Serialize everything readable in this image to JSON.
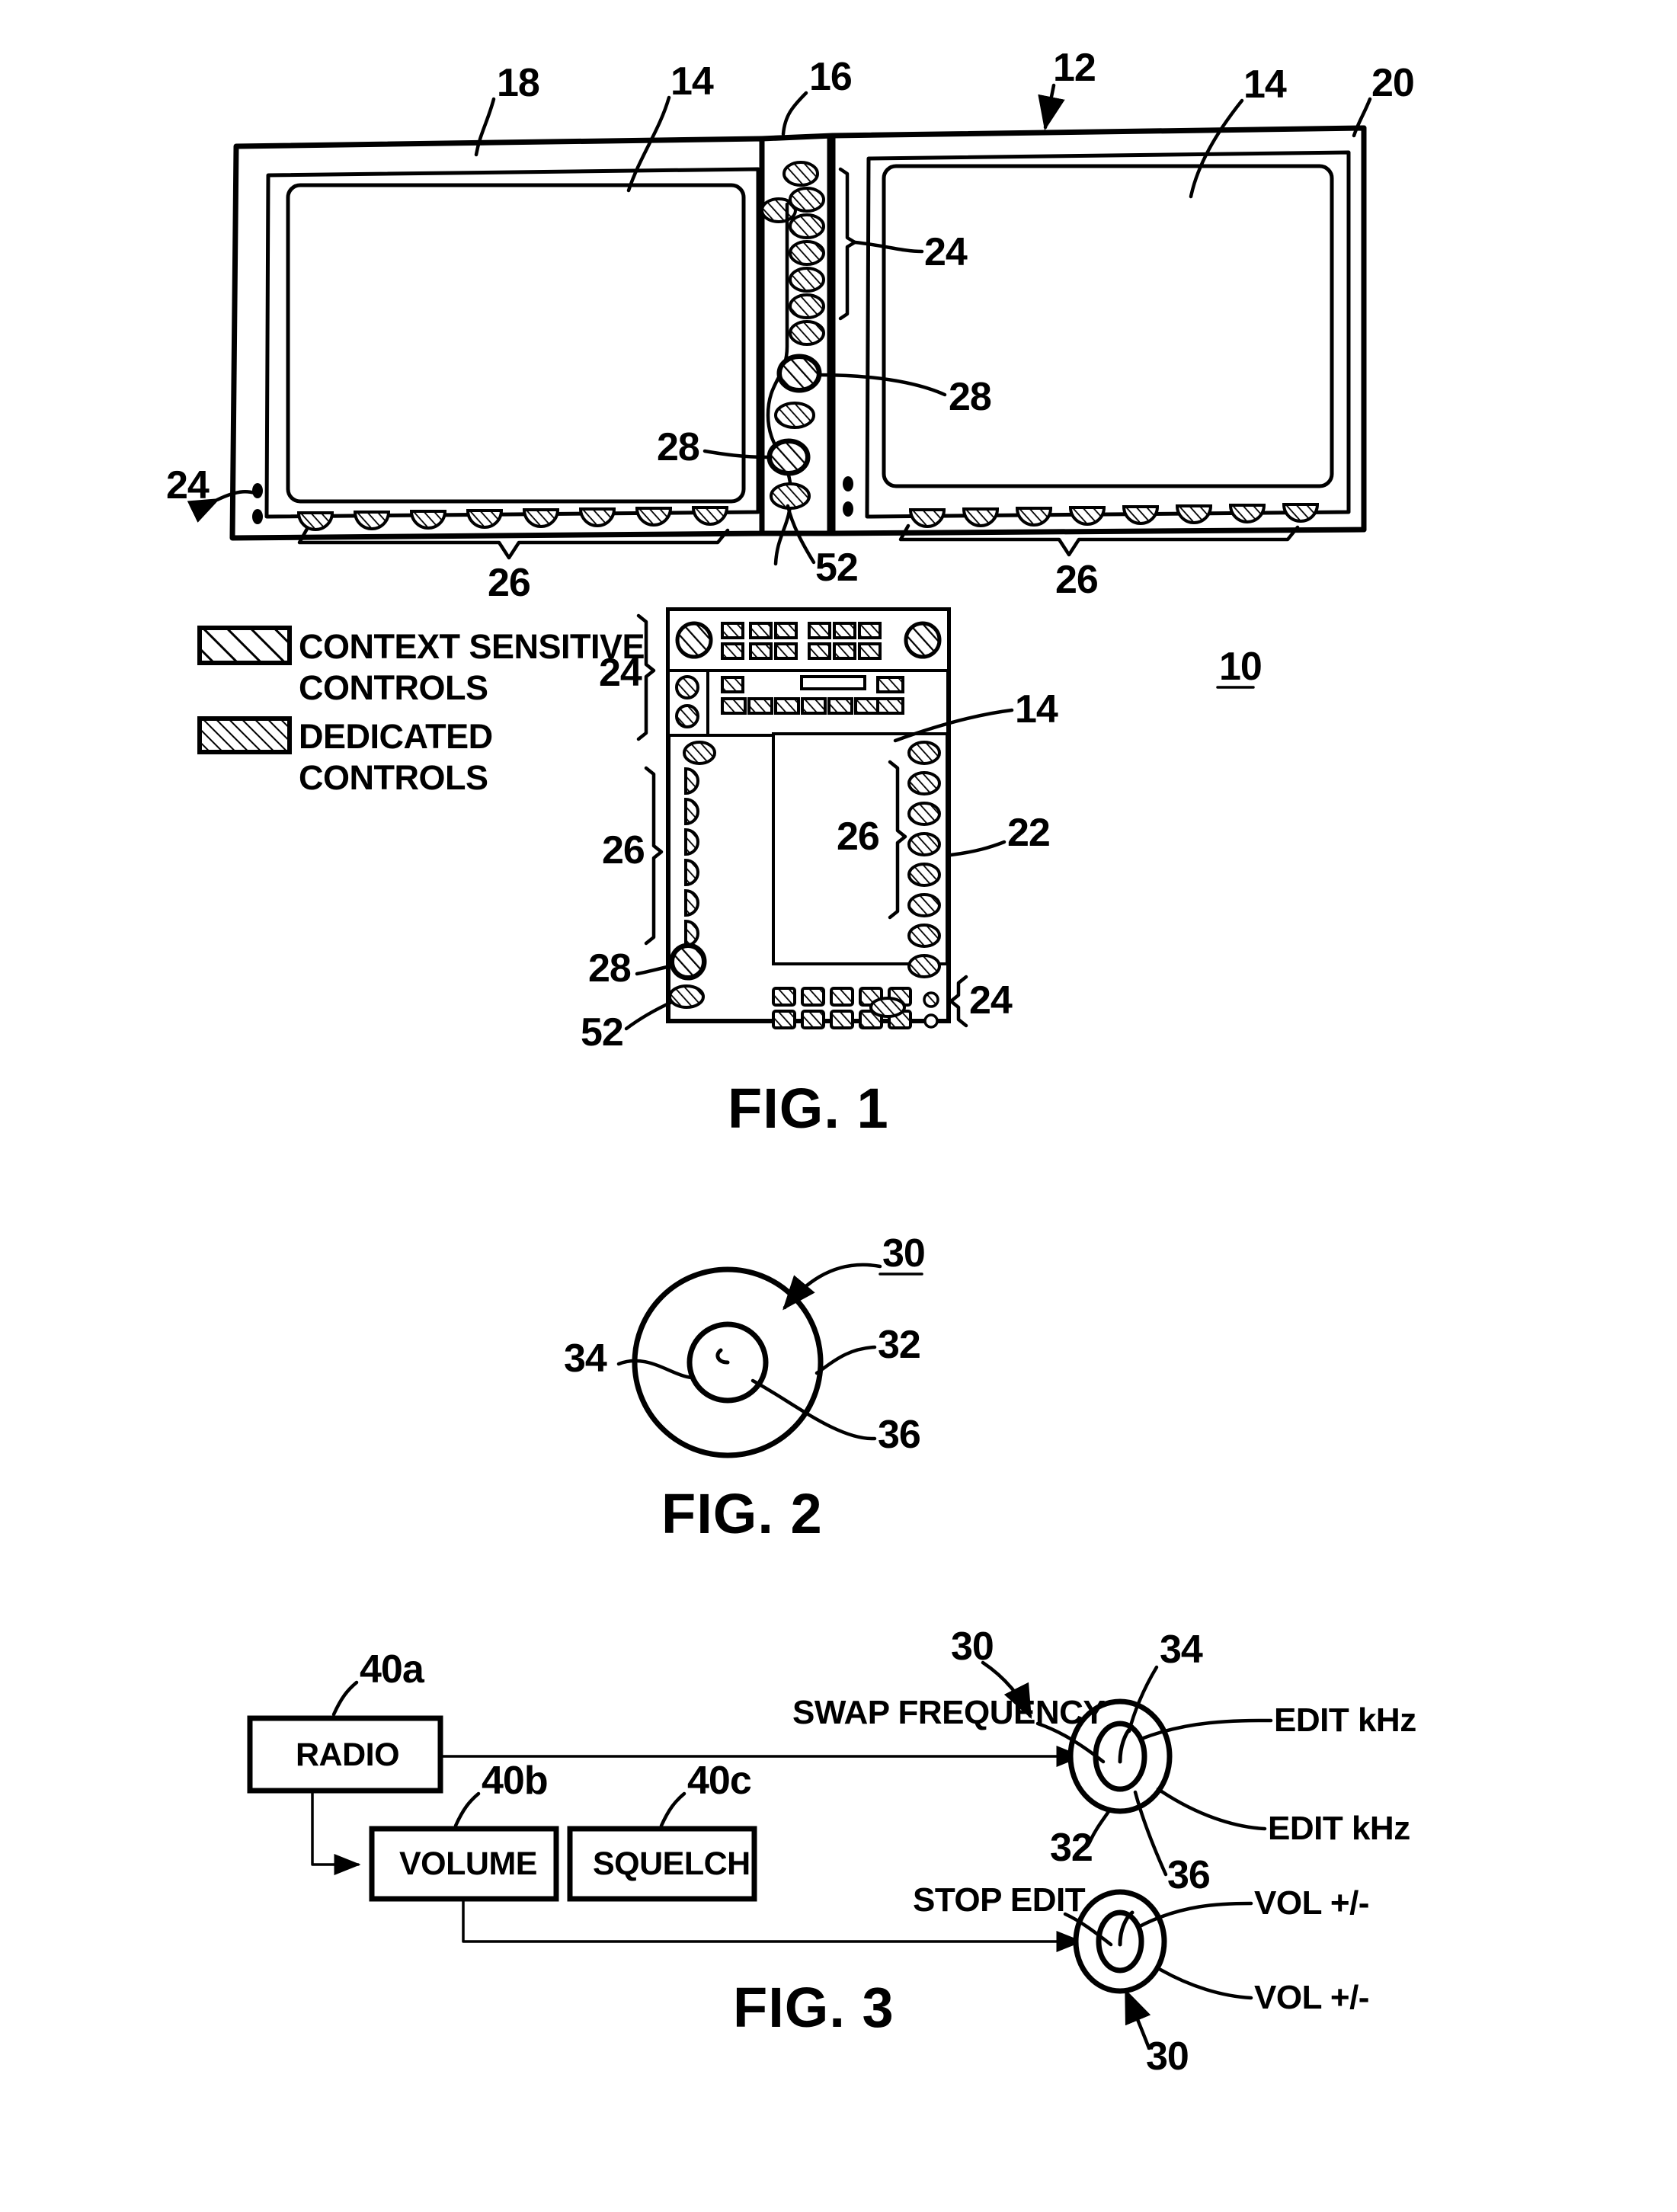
{
  "document": {
    "kind": "patent-drawing-sheet",
    "figures": [
      "FIG. 1",
      "FIG. 2",
      "FIG. 3"
    ]
  },
  "fig1": {
    "title": "FIG. 1",
    "assembly_ref": "10",
    "reference_numerals": {
      "left_bezel": "18",
      "display_left": "14",
      "center_bezel": "16",
      "assembly_arrow": "12",
      "display_right": "14",
      "right_bezel": "20",
      "context_column": "24",
      "knob_upper": "28",
      "knob_lower": "28",
      "knob_small": "52",
      "bottom_row_left": "26",
      "bottom_row_right": "26",
      "left_indicator": "24",
      "unit_display": "14",
      "unit_top_controls": "24",
      "unit_left_column": "26",
      "unit_inner_right": "26",
      "unit_body": "22",
      "unit_knob": "28",
      "unit_small_knob": "52",
      "unit_bottom_controls": "24",
      "system": "10"
    },
    "legend": {
      "items": [
        {
          "swatch": "coarse-hatch",
          "line1": "CONTEXT SENSITIVE",
          "line2": "CONTROLS"
        },
        {
          "swatch": "fine-hatch",
          "line1": "DEDICATED",
          "line2": "CONTROLS"
        }
      ]
    },
    "left_panel": {
      "bottom_button_count": 8
    },
    "right_panel": {
      "bottom_button_count": 8
    },
    "center_column": {
      "small_button_count": 8,
      "knob_count": 2,
      "small_knob_count": 2
    },
    "unit22": {
      "top_keypad_rows": 2,
      "top_keypad_cols": 6,
      "second_keypad_cols": 8,
      "left_bezel_buttons": 7,
      "right_bezel_buttons": 8,
      "bottom_keypad_rows": 2,
      "bottom_keypad_cols": 5
    }
  },
  "fig2": {
    "title": "FIG. 2",
    "reference_numerals": {
      "knob_assembly": "30",
      "outer_ring": "32",
      "inner_knob": "34",
      "center_detent": "36"
    }
  },
  "fig3": {
    "title": "FIG. 3",
    "blocks": [
      {
        "label": "RADIO",
        "ref": "40a"
      },
      {
        "label": "VOLUME",
        "ref": "40b"
      },
      {
        "label": "SQUELCH",
        "ref": "40c"
      }
    ],
    "knob_top": {
      "ref_assembly": "30",
      "ref_inner": "34",
      "ref_outer": "32",
      "ref_center": "36",
      "left_label": "SWAP FREQUENCY",
      "right_label_upper": "EDIT kHz",
      "right_label_lower": "EDIT kHz"
    },
    "knob_bottom": {
      "ref_assembly": "30",
      "left_label": "STOP EDIT",
      "right_label_upper": "VOL +/-",
      "right_label_lower": "VOL +/-"
    }
  },
  "colors": {
    "ink": "#000000",
    "paper": "#ffffff"
  }
}
